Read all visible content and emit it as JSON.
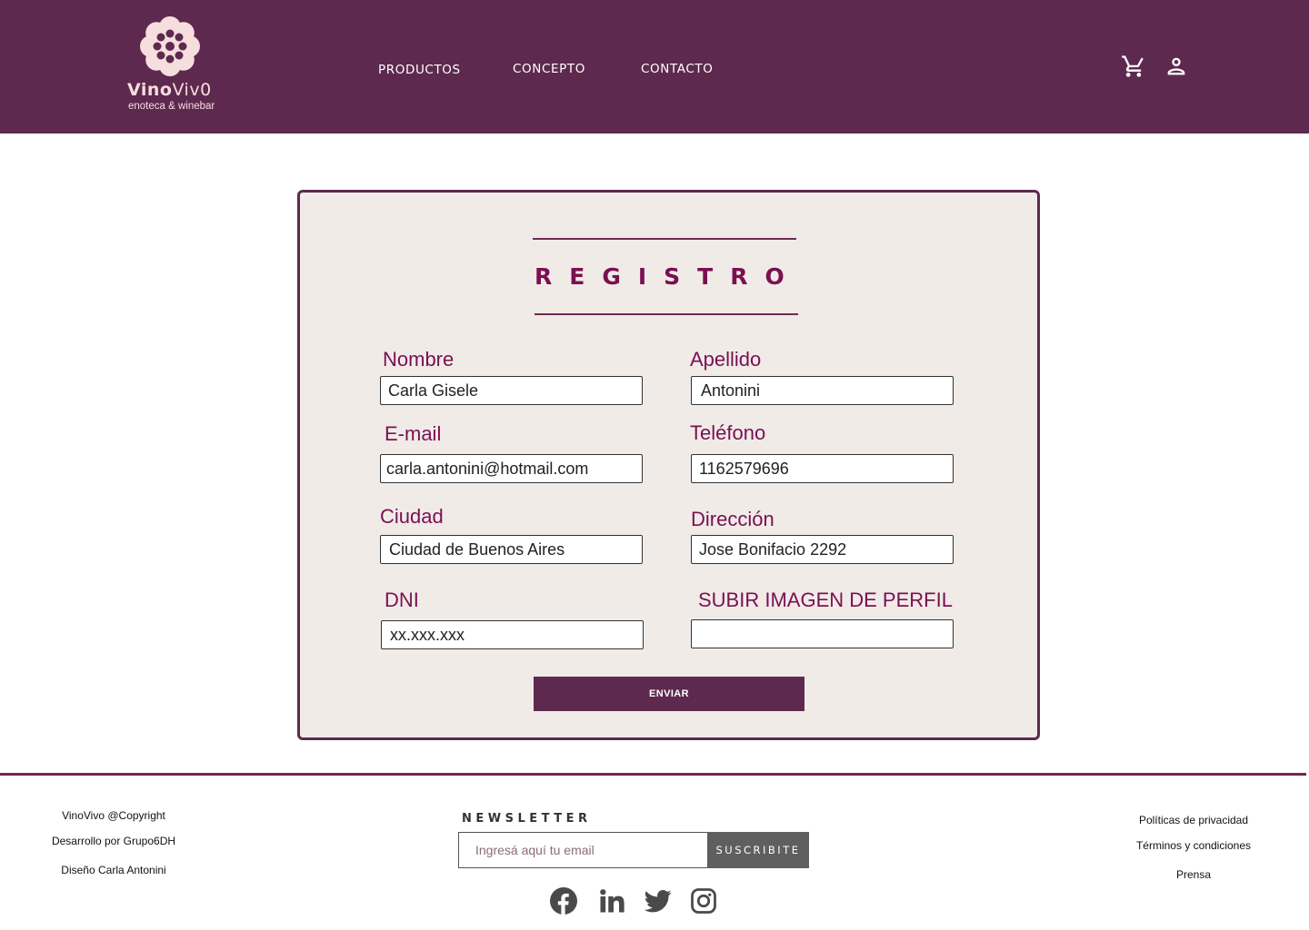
{
  "colors": {
    "brand": "#5e294f",
    "label": "#7a1052",
    "card_bg": "#f0ebe7",
    "logo": "#f6dede"
  },
  "header": {
    "logo": {
      "name_a": "Vino",
      "name_b": "Viv0",
      "tagline": "enoteca & winebar",
      "icon": "vine-flower-logo-icon"
    },
    "nav": {
      "productos": "PRODUCTOS",
      "concepto": "CONCEPTO",
      "contacto": "CONTACTO"
    },
    "icons": {
      "cart": "cart-icon",
      "user": "user-icon"
    }
  },
  "form": {
    "title": "REGISTRO",
    "nombre": {
      "label": "Nombre",
      "value": "Carla Gisele"
    },
    "apellido": {
      "label": "Apellido",
      "value": "Antonini"
    },
    "email": {
      "label": "E-mail",
      "value": "carla.antonini@hotmail.com"
    },
    "telefono": {
      "label": "Teléfono",
      "value": "1162579696"
    },
    "ciudad": {
      "label": "Ciudad",
      "value": "Ciudad de Buenos Aires"
    },
    "direccion": {
      "label": "Dirección",
      "value": "Jose Bonifacio 2292"
    },
    "dni": {
      "label": "DNI",
      "placeholder": "xx.xxx.xxx"
    },
    "imagen": {
      "label": "SUBIR IMAGEN DE PERFIL",
      "value": ""
    },
    "submit": "ENVIAR"
  },
  "footer": {
    "left": {
      "copyright": "VinoVivo @Copyright",
      "dev": "Desarrollo por Grupo6DH",
      "design": "Diseño Carla Antonini"
    },
    "newsletter": {
      "title": "NEWSLETTER",
      "placeholder": "Ingresá aquí tu email",
      "button": "SUSCRIBITE"
    },
    "right": {
      "privacy": "Políticas de privacidad",
      "terms": "Términos y condiciones",
      "press": "Prensa"
    },
    "social": [
      "facebook-icon",
      "linkedin-icon",
      "twitter-icon",
      "instagram-icon"
    ]
  }
}
